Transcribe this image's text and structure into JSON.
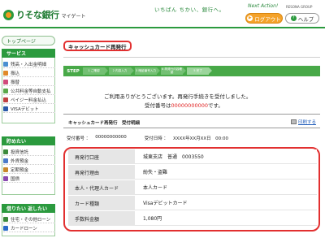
{
  "header": {
    "logo_text": "りそな銀行",
    "logo_sub": "マイゲート",
    "tagline": "いちばん ちかい、銀行へ。",
    "brand_note": "Next Action!",
    "brand_group": "RESONA GROUP",
    "logout_label": "ログアウト",
    "help_label": "ヘルプ"
  },
  "sidebar": {
    "top_page": "トップページ",
    "service_head": "サービス",
    "service_items": [
      "残高・入出金明細",
      "振込",
      "振替",
      "公共料金等自動支払",
      "ペイジー料金払込",
      "VISAデビット"
    ],
    "save_head": "貯めたい",
    "save_items": [
      "投資信託",
      "外貨預金",
      "定期預金",
      "国債"
    ],
    "borrow_head": "借りたい 返したい",
    "borrow_items": [
      "住宅・その他ローン",
      "カードローン"
    ]
  },
  "main": {
    "page_title": "キャッシュカード再発行",
    "steps_label": "STEP",
    "steps": [
      "1 ご確認",
      "2 内容入力",
      "3 暗証番号入力",
      "4 再発行内容確認",
      "5 完了"
    ],
    "thanks_msg": "ご利用ありがとうございます。再発行手続きを受付しました。",
    "receipt_prefix": "受付番号は",
    "receipt_no": "00000000000",
    "receipt_suffix": "です。",
    "section_head": "キャッシュカード再発行　受付明細",
    "print_label": "印刷する",
    "meta_receipt_label": "受付番号 ：",
    "meta_receipt_value": "00000000000",
    "meta_date_label": "受付日時 ：",
    "meta_date_value": "XXXX年XX月XX日　00:00",
    "rows": [
      {
        "label": "再発行口座",
        "value": "城東支店　普通　0003550"
      },
      {
        "label": "再発行理由",
        "value": "紛失・盗難"
      },
      {
        "label": "本人・代理人カード",
        "value": "本人カード"
      },
      {
        "label": "カード種類",
        "value": "Visaデビットカード"
      },
      {
        "label": "手数料金額",
        "value": "1,080円"
      }
    ]
  },
  "colors": {
    "brand_green": "#2b9a3e",
    "accent_orange": "#f4a22a",
    "highlight_red": "#e23030"
  }
}
